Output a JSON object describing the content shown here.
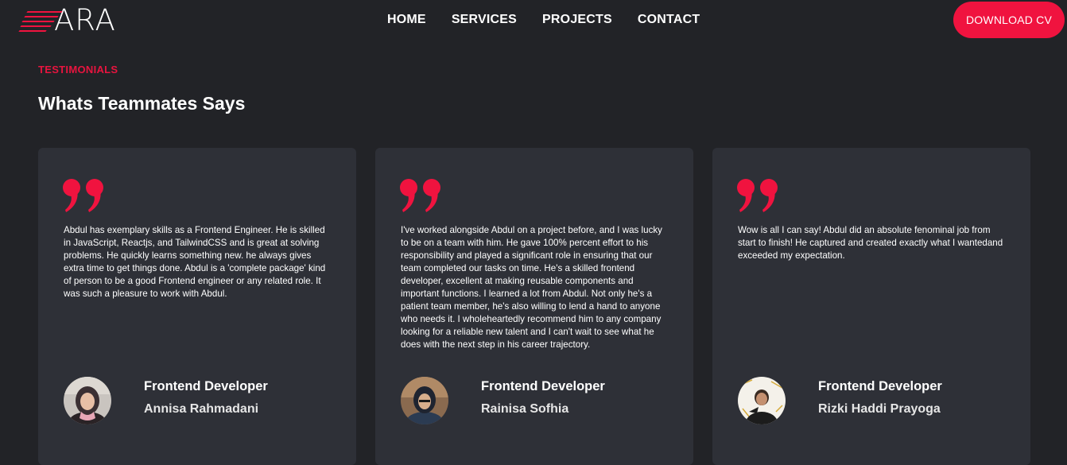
{
  "header": {
    "logo_text": "ARA",
    "nav": [
      "HOME",
      "SERVICES",
      "PROJECTS",
      "CONTACT"
    ],
    "cta_label": "DOWNLOAD CV"
  },
  "section": {
    "eyebrow": "TESTIMONIALS",
    "title": "Whats Teammates Says"
  },
  "testimonials": [
    {
      "quote": "Abdul has exemplary skills as a Frontend Engineer. He is skilled in JavaScript, Reactjs, and TailwindCSS and is great at solving problems. He quickly learns something new. he always gives extra time to get things done. Abdul is a 'complete package' kind of person to be a good Frontend engineer or any related role. It was such a pleasure to work with Abdul.",
      "role": "Frontend Developer",
      "name": "Annisa Rahmadani",
      "avatar_icon": "avatar-photo"
    },
    {
      "quote": "I've worked alongside Abdul on a project before, and I was lucky to be on a team with him. He gave 100% percent effort to his responsibility and played a significant role in ensuring that our team completed our tasks on time. He's a skilled frontend developer, excellent at making reusable components and important functions. I learned a lot from Abdul. Not only he's a patient team member, he's also willing to lend a hand to anyone who needs it. I wholeheartedly recommend him to any company looking for a reliable new talent and I can't wait to see what he does with the next step in his career trajectory.",
      "role": "Frontend Developer",
      "name": "Rainisa Sofhia",
      "avatar_icon": "avatar-photo"
    },
    {
      "quote": "Wow is all I can say! Abdul did an absolute fenominal job from start to finish! He captured and created exactly what I wantedand exceeded my expectation.",
      "role": "Frontend Developer",
      "name": "Rizki Haddi Prayoga",
      "avatar_icon": "avatar-photo"
    }
  ],
  "colors": {
    "background": "#222327",
    "card": "#2e3037",
    "accent": "#f0133f",
    "text": "#ffffff"
  }
}
